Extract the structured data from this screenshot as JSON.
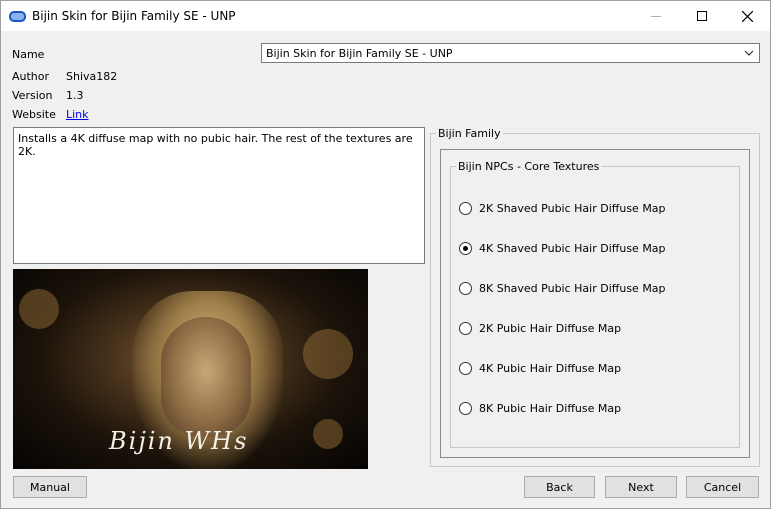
{
  "window": {
    "title": "Bijin Skin for Bijin Family SE - UNP",
    "icon": "installer-app-icon"
  },
  "info": {
    "name_label": "Name",
    "author_label": "Author",
    "author_value": "Shiva182",
    "version_label": "Version",
    "version_value": "1.3",
    "website_label": "Website",
    "website_link": "Link"
  },
  "name_select": {
    "value": "Bijin Skin for Bijin Family SE - UNP"
  },
  "description": "Installs a 4K diffuse map with no pubic hair. The rest of the textures are 2K.",
  "preview": {
    "signature": "Bijin WHs"
  },
  "outer_group": {
    "title": "Bijin Family"
  },
  "inner_group": {
    "title": "Bijin NPCs - Core Textures",
    "options": [
      {
        "label": "2K Shaved Pubic Hair Diffuse Map",
        "checked": false
      },
      {
        "label": "4K Shaved Pubic Hair Diffuse Map",
        "checked": true
      },
      {
        "label": "8K Shaved Pubic Hair Diffuse Map",
        "checked": false
      },
      {
        "label": "2K Pubic Hair Diffuse Map",
        "checked": false
      },
      {
        "label": "4K Pubic Hair Diffuse Map",
        "checked": false
      },
      {
        "label": "8K Pubic Hair Diffuse Map",
        "checked": false
      }
    ]
  },
  "buttons": {
    "manual": "Manual",
    "back": "Back",
    "next": "Next",
    "cancel": "Cancel"
  },
  "colors": {
    "link": "#0000ee",
    "button_face": "#e1e1e1",
    "window_bg": "#f0f0f0"
  }
}
